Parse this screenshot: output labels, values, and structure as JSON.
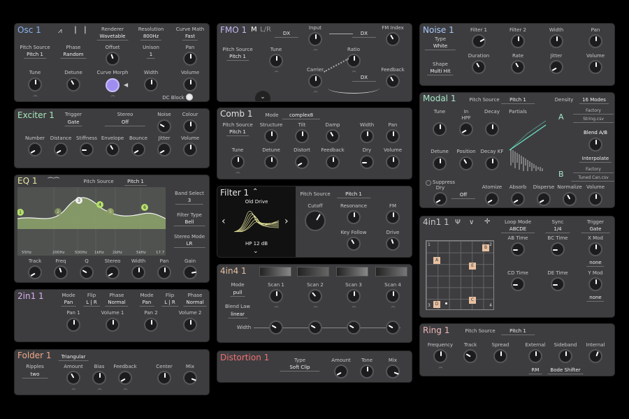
{
  "osc": {
    "title": "Osc 1",
    "renderer_label": "Renderer",
    "renderer": "Wavetable",
    "resolution_label": "Resolution",
    "resolution": "800Hz",
    "curvemath_label": "Curve Math",
    "curvemath": "Fast",
    "pitchsource_label": "Pitch Source",
    "pitchsource": "Pitch 1",
    "phase_label": "Phase",
    "phase": "Random",
    "offset_label": "Offset",
    "unison_label": "Unison",
    "unison": "1",
    "pan_label": "Pan",
    "tune_label": "Tune",
    "detune_label": "Detune",
    "morph_label": "Curve Morph",
    "width_label": "Width",
    "volume_label": "Volume",
    "dcblock_label": "DC Block"
  },
  "exciter": {
    "title": "Exciter 1",
    "trigger_label": "Trigger",
    "trigger": "Gate",
    "stereo_label": "Stereo",
    "stereo": "Off",
    "noise_label": "Noise",
    "colour_label": "Colour",
    "number_label": "Number",
    "distance_label": "Distance",
    "stiffness_label": "Stiffness",
    "envelope_label": "Envelope",
    "bounce_label": "Bounce",
    "jitter_label": "Jitter",
    "volume_label": "Volume"
  },
  "eq": {
    "title": "EQ 1",
    "pitchsource_label": "Pitch Source",
    "pitchsource": "Pitch 1",
    "bandselect_label": "Band Select",
    "bandselect": "3",
    "filtertype_label": "Filter Type",
    "filtertype": "Bell",
    "stereomode_label": "Stereo Mode",
    "stereomode": "LR",
    "freqs": [
      "55Hz",
      "200Hz",
      "500Hz",
      "1kHz",
      "2kHz",
      "5kHz",
      "17.7"
    ],
    "bands": [
      "1",
      "2",
      "3",
      "4",
      "5",
      "6"
    ],
    "track_label": "Track",
    "freq_label": "Freq",
    "q_label": "Q",
    "stereo_label": "Stereo",
    "width_label": "Width",
    "pan_label": "Pan",
    "gain_label": "Gain"
  },
  "twoin1": {
    "title": "2in1 1",
    "mode_label": "Mode",
    "mode1": "Pan",
    "flip_label": "Flip",
    "flip1": "L | R",
    "phase_label": "Phase",
    "phase1": "Normal",
    "mode2": "Pan",
    "flip2": "L | R",
    "phase2": "Normal",
    "pan1_label": "Pan 1",
    "vol1_label": "Volume 1",
    "pan2_label": "Pan 2",
    "vol2_label": "Volume 2"
  },
  "folder": {
    "title": "Folder 1",
    "shape": "Triangular",
    "ripples_label": "Ripples",
    "ripples": "two",
    "amount_label": "Amount",
    "bias_label": "Bias",
    "feedback_label": "Feedback",
    "center_label": "Center",
    "mix_label": "Mix"
  },
  "fmo": {
    "title": "FMO 1",
    "mode": "M",
    "lr": "L/R",
    "pitchsource_label": "Pitch Source",
    "pitchsource": "Pitch 1",
    "tune_label": "Tune",
    "input_label": "Input",
    "dx1": "DX",
    "dx2": "DX",
    "dx3": "DX",
    "fmindex_label": "FM Index",
    "ratio_label": "Ratio",
    "carrier_label": "Carrier",
    "feedback_label": "Feedback"
  },
  "comb": {
    "title": "Comb 1",
    "mode_label": "Mode",
    "mode": "complex8",
    "pitchsource_label": "Pitch Source",
    "pitchsource": "Pitch 1",
    "structure_label": "Structure",
    "tilt_label": "Tilt",
    "damp_label": "Damp",
    "width_label": "Width",
    "pan_label": "Pan",
    "tune_label": "Tune",
    "detune_label": "Detune",
    "distort_label": "Distort",
    "feedback_label": "Feedback",
    "dry_label": "Dry",
    "volume_label": "Volume"
  },
  "filter": {
    "title": "Filter 1",
    "preset": "Old Drive",
    "type": "HP 12 dB",
    "pitchsource_label": "Pitch Source",
    "pitchsource": "Pitch 1",
    "cutoff_label": "Cutoff",
    "resonance_label": "Resonance",
    "fm_label": "FM",
    "keyfollow_label": "Key Follow",
    "drive_label": "Drive"
  },
  "fourin4": {
    "title": "4in4 1",
    "mode_label": "Mode",
    "mode": "pull",
    "blendlaw_label": "Blend Law",
    "blendlaw": "linear",
    "width_label": "Width",
    "scan1_label": "Scan 1",
    "scan2_label": "Scan 2",
    "scan3_label": "Scan 3",
    "scan4_label": "Scan 4"
  },
  "distortion": {
    "title": "Distortion 1",
    "type_label": "Type",
    "type": "Soft Clip",
    "amount_label": "Amount",
    "tone_label": "Tone",
    "mix_label": "Mix"
  },
  "noise": {
    "title": "Noise 1",
    "type_label": "Type",
    "type": "White",
    "filter1_label": "Filter 1",
    "filter2_label": "Filter 2",
    "width_label": "Width",
    "pan_label": "Pan",
    "shape_label": "Shape",
    "shape": "Multi Hit",
    "duration_label": "Duration",
    "rate_label": "Rate",
    "jitter_label": "Jitter",
    "volume_label": "Volume"
  },
  "modal": {
    "title": "Modal 1",
    "pitchsource_label": "Pitch Source",
    "pitchsource": "Pitch 1",
    "density_label": "Density",
    "density": "16 Modes",
    "tune_label": "Tune",
    "in_label": "In",
    "hpf_label": "HPF",
    "decay_label": "Decay",
    "partials_label": "Partials",
    "detune_label": "Detune",
    "position_label": "Position",
    "decaykf_label": "Decay KF",
    "a_label": "A",
    "a_bank": "Factory",
    "a_file": "String.csv",
    "blend_label": "Blend A/B",
    "blend": "Interpolate",
    "b_label": "B",
    "b_bank": "Factory",
    "b_file": "Tuned Can.csv",
    "suppress_label": "Suppress",
    "dry_label": "Dry",
    "dry": "Off",
    "atomize_label": "Atomize",
    "absorb_label": "Absorb",
    "disperse_label": "Disperse",
    "normalize_label": "Normalize",
    "volume_label": "Volume"
  },
  "fourin1": {
    "title": "4in1 1",
    "loopmode_label": "Loop Mode",
    "loopmode": "ABCDE",
    "sync_label": "Sync",
    "sync": "1/4",
    "trigger_label": "Trigger",
    "trigger": "Gate",
    "abtime_label": "AB Time",
    "bctime_label": "BC Time",
    "xmod_label": "X Mod",
    "xmod": "none",
    "cdtime_label": "CD Time",
    "detime_label": "DE Time",
    "ymod_label": "Y Mod",
    "ymod": "none",
    "corner1": "1",
    "corner2": "2",
    "corner3": "3",
    "corner4": "4",
    "nodeA": "A",
    "nodeB": "B",
    "nodeC": "C",
    "nodeD": "D",
    "nodeE": "E"
  },
  "ring": {
    "title": "Ring 1",
    "pitchsource_label": "Pitch Source",
    "pitchsource": "Pitch 1",
    "frequency_label": "Frequency",
    "track_label": "Track",
    "spread_label": "Spread",
    "external_label": "External",
    "external": "RM",
    "sideband_label": "Sideband",
    "sideband": "Bode Shifter",
    "internal_label": "Internal"
  },
  "colors": {
    "osc": "#8ab4f0",
    "exciter": "#a8e8b8",
    "eq": "#e6e6a0",
    "twoin1": "#d8b0f0",
    "folder": "#f0a888",
    "fmo": "#c0b8f0",
    "comb": "#e0e0e0",
    "filter": "#e8e8e8",
    "fourin4": "#e8c0a0",
    "distortion": "#f07070",
    "noise": "#a8c8f8",
    "modal": "#a8e8c8",
    "fourin1": "#c8c8c8",
    "ring": "#f0b8b8"
  }
}
